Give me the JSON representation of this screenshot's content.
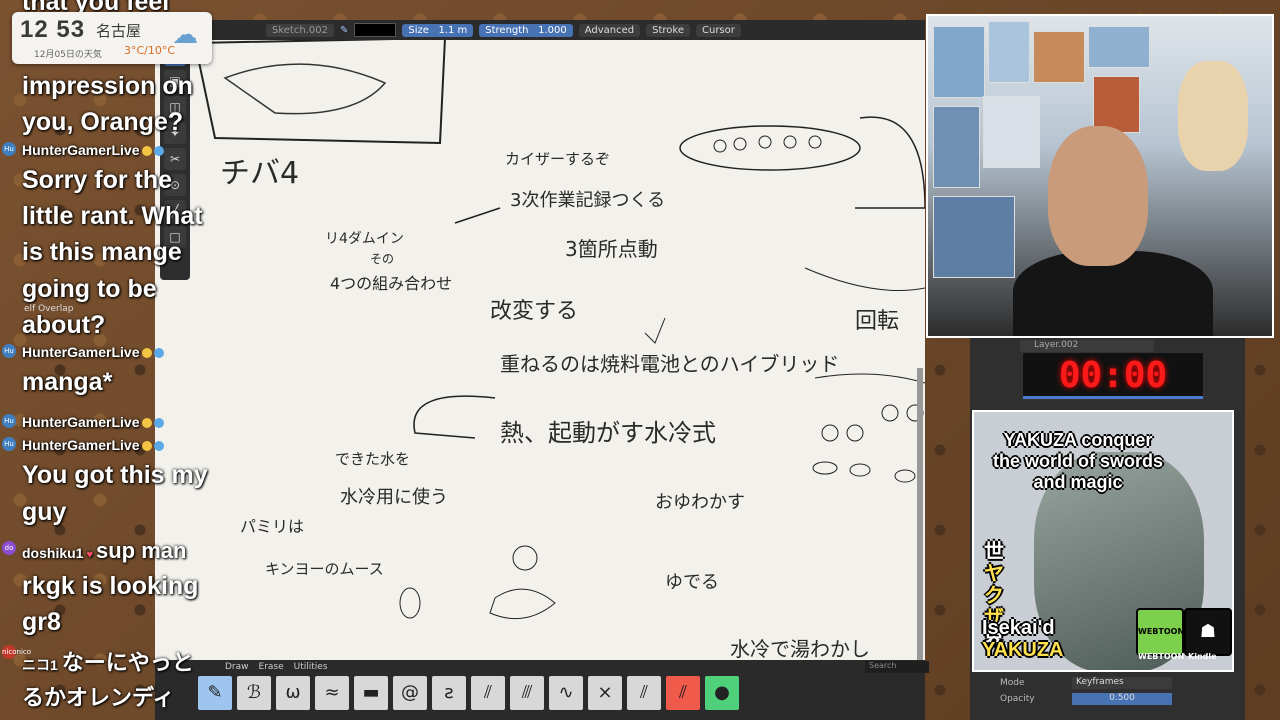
{
  "clock": {
    "time": "12 53",
    "city": "名古屋",
    "date": "12月05日の天気",
    "temp": "3°C/10°C",
    "icon": "rain-cloud-icon"
  },
  "header": {
    "sketch_name": "Sketch.002",
    "size_label": "Size",
    "size_value": "1.1 m",
    "strength_label": "Strength",
    "strength_value": "1.000",
    "advanced": "Advanced",
    "stroke": "Stroke",
    "cursor": "Cursor"
  },
  "chat": {
    "partial_top": "that you feel",
    "lines": [
      {
        "type": "msg",
        "text": "impression on"
      },
      {
        "type": "msg",
        "text": "you, Orange?"
      },
      {
        "type": "user",
        "text": "HunterGamerLive"
      },
      {
        "type": "msg",
        "text": "Sorry for the"
      },
      {
        "type": "msg",
        "text": "little rant. What"
      },
      {
        "type": "msg",
        "text": "is this mange"
      },
      {
        "type": "msg",
        "text": "going to be"
      },
      {
        "type": "msg",
        "text": "about?"
      },
      {
        "type": "user",
        "text": "HunterGamerLive"
      },
      {
        "type": "msg",
        "text": "manga*"
      },
      {
        "type": "user",
        "text": "HunterGamerLive"
      },
      {
        "type": "user",
        "text": "HunterGamerLive"
      },
      {
        "type": "msg",
        "text": "You got this my"
      },
      {
        "type": "msg",
        "text": "guy"
      },
      {
        "type": "user",
        "text": "doshiku1"
      },
      {
        "type": "msg",
        "text": "sup man"
      },
      {
        "type": "msg",
        "text": "rkgk is looking"
      },
      {
        "type": "msg",
        "text": "gr8"
      },
      {
        "type": "user",
        "text": "ニコ1"
      },
      {
        "type": "msg",
        "text": "なーにやっと"
      },
      {
        "type": "msg",
        "text": "るかオレンディ"
      }
    ],
    "overlap_label": "elf Overlap"
  },
  "sketch": {
    "labels": [
      "チバ4",
      "カイザーするぞ",
      "3次作業記録つくる",
      "3箇所点動",
      "リ4ダムイン",
      "その",
      "4つの組み合わせ",
      "改変する",
      "重ねるのは焼料電池とのハイブリッド",
      "熱、起動がす水冷式",
      "できた水を",
      "水冷用に使う",
      "おゆわかす",
      "パミリは",
      "キンヨーのムース",
      "ゆでる",
      "水冷で湯わかし",
      "回転"
    ]
  },
  "brushbar": {
    "tabs": [
      "Draw",
      "Erase",
      "Utilities"
    ],
    "search_placeholder": "Search"
  },
  "timer": {
    "value": "00:00"
  },
  "layer": {
    "name": "Layer.002"
  },
  "book": {
    "title": "YAKUZA conquer the world of swords and magic",
    "jp_vertical": [
      "世",
      "ヤ",
      "ク",
      "ザ",
      "界"
    ],
    "isekai_line1": "Isekai'd",
    "isekai_line2": "YAKUZA",
    "badge_webtoon": "WEBTOON",
    "badge_kindle": "Kindle",
    "cap_webtoon": "WEBTOON",
    "cap_kindle": "Kindle"
  },
  "props": {
    "mode_label": "Mode",
    "mode_value": "Keyframes",
    "opacity_label": "Opacity",
    "opacity_value": "0.500"
  }
}
